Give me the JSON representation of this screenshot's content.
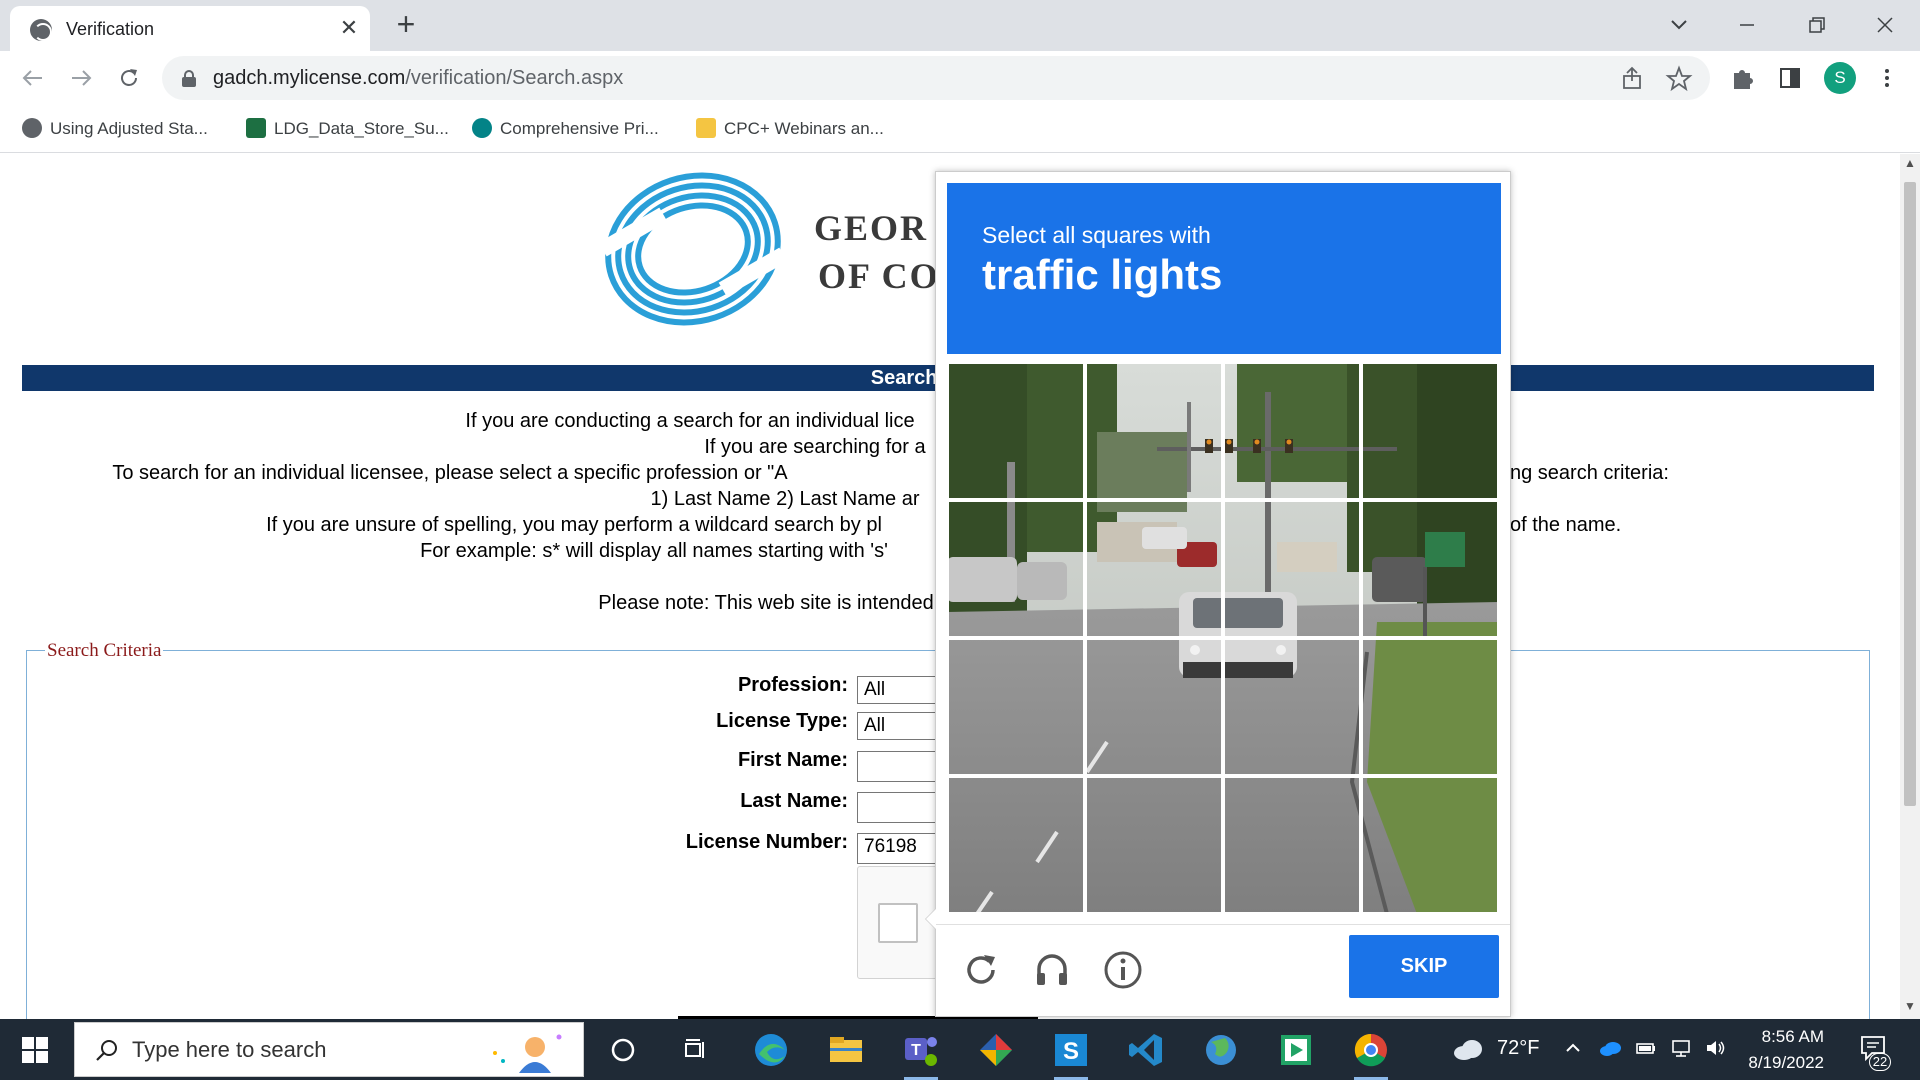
{
  "browser": {
    "tab_title": "Verification",
    "tab_close": "✕",
    "new_tab": "+",
    "url_host": "gadch.mylicense.com",
    "url_path": "/verification/Search.aspx",
    "profile_initial": "S"
  },
  "bookmarks": [
    {
      "label": "Using Adjusted Sta...",
      "icon": "globe-icon",
      "color": "#5f6368"
    },
    {
      "label": "LDG_Data_Store_Su...",
      "icon": "excel-icon",
      "color": "#1d6f42"
    },
    {
      "label": "Comprehensive Pri...",
      "icon": "sharepoint-icon",
      "color": "#038387"
    },
    {
      "label": "CPC+ Webinars an...",
      "icon": "folder-icon",
      "color": "#f4c542"
    }
  ],
  "page": {
    "org_line1": "GEOR",
    "org_line2": "OF CO",
    "banner": "Search for a Pro",
    "intro_lines": [
      "If you are conducting a search for an individual lice",
      "If you are searching for a",
      "To search for an individual licensee, please select a specific profession or \"A",
      "ng search criteria:",
      "1) Last Name 2) Last Name ar",
      "If you are unsure of spelling, you may perform a wildcard search by pl",
      "of the name.",
      "For example: s* will display all names starting with 's'",
      "Please note: This web site is intended"
    ],
    "criteria_legend": "Search Criteria",
    "form": {
      "profession_label": "Profession:",
      "profession_value": "All",
      "license_type_label": "License Type:",
      "license_type_value": "All",
      "first_name_label": "First Name:",
      "first_name_value": "",
      "last_name_label": "Last Name:",
      "last_name_value": "",
      "license_number_label": "License Number:",
      "license_number_value": "76198"
    }
  },
  "captcha": {
    "instruction": "Select all squares with",
    "target": "traffic lights",
    "grid_rows": 4,
    "grid_cols": 4,
    "skip_label": "SKIP",
    "accent_color": "#1a73e8",
    "footer_icons": [
      "reload-icon",
      "audio-icon",
      "info-icon"
    ]
  },
  "taskbar": {
    "search_placeholder": "Type here to search",
    "weather": "72°F",
    "time": "8:56 AM",
    "date": "8/19/2022",
    "notification_count": "22"
  }
}
